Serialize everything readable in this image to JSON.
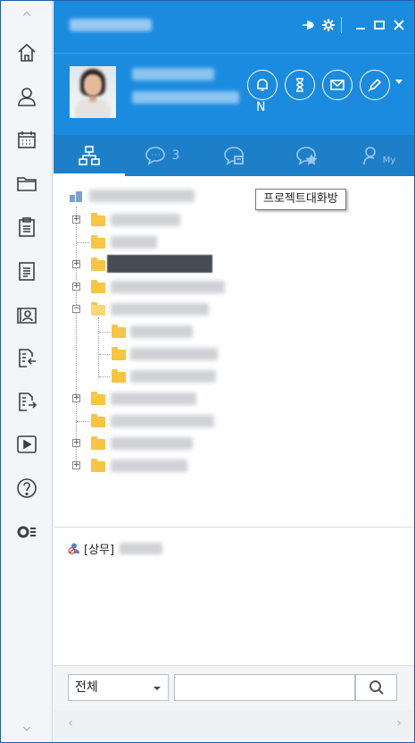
{
  "rail": {
    "items": [
      {
        "name": "scroll-up-icon"
      },
      {
        "name": "home-icon"
      },
      {
        "name": "person-icon"
      },
      {
        "name": "calendar-icon"
      },
      {
        "name": "folder-icon"
      },
      {
        "name": "clipboard-icon"
      },
      {
        "name": "document-icon"
      },
      {
        "name": "contact-book-icon"
      },
      {
        "name": "inbox-transfer-icon"
      },
      {
        "name": "outbox-transfer-icon"
      },
      {
        "name": "play-icon"
      },
      {
        "name": "help-icon"
      },
      {
        "name": "toggle-menu-icon"
      },
      {
        "name": "scroll-down-icon"
      }
    ]
  },
  "titlebar": {
    "icons": [
      "pin-icon",
      "gear-icon",
      "minimize-icon",
      "maximize-icon",
      "close-icon"
    ]
  },
  "profile": {
    "notification_letter": "N",
    "actions": [
      "bell-icon",
      "hourglass-icon",
      "mail-icon",
      "pen-icon"
    ]
  },
  "tabs": [
    {
      "name": "tab-organization",
      "icon": "org-chart-icon",
      "active": true,
      "badge": ""
    },
    {
      "name": "tab-chat",
      "icon": "chat-bubble-icon",
      "active": false,
      "badge": "3"
    },
    {
      "name": "tab-project-chat",
      "icon": "project-chat-icon",
      "active": false,
      "badge": ""
    },
    {
      "name": "tab-favorite-chat",
      "icon": "star-chat-icon",
      "active": false,
      "badge": ""
    },
    {
      "name": "tab-my",
      "icon": "my-icon",
      "active": false,
      "badge": "",
      "suffix": "My"
    }
  ],
  "tooltip": {
    "text": "프로젝트대화방"
  },
  "member": {
    "title_prefix": "[상무]"
  },
  "search": {
    "scope_value": "전체",
    "query_value": "",
    "placeholder": ""
  },
  "colors": {
    "header_blue": "#1b8be0",
    "tab_blue": "#1e7fc9",
    "folder_yellow": "#f7c444"
  }
}
